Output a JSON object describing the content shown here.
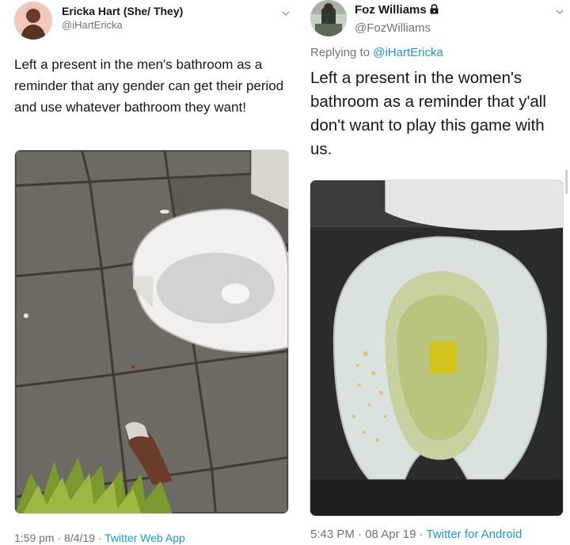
{
  "left_tweet": {
    "display_name": "Ericka Hart (She/ They)",
    "handle": "@iHartEricka",
    "text": "Left a present in the men's bathroom as a reminder that any gender can get their period and use whatever bathroom they want!",
    "time": "1:59 pm · 8/4/19 · ",
    "source": "Twitter Web App",
    "menu_icon": "chevron-down-icon"
  },
  "right_tweet": {
    "display_name": "Foz Williams",
    "handle": "@FozWilliams",
    "protected_icon": "lock-icon",
    "reply_prefix": "Replying to ",
    "reply_mention": "@iHartEricka",
    "text": "Left a present in the women's bathroom as a reminder that y'all don't want to play this game with us.",
    "time": "5:43 PM · 08 Apr 19 · ",
    "source": "Twitter for Android",
    "menu_icon": "chevron-down-icon"
  },
  "colors": {
    "link": "#1b95e0",
    "secondary_text": "#657786",
    "primary_text": "#14171a"
  }
}
